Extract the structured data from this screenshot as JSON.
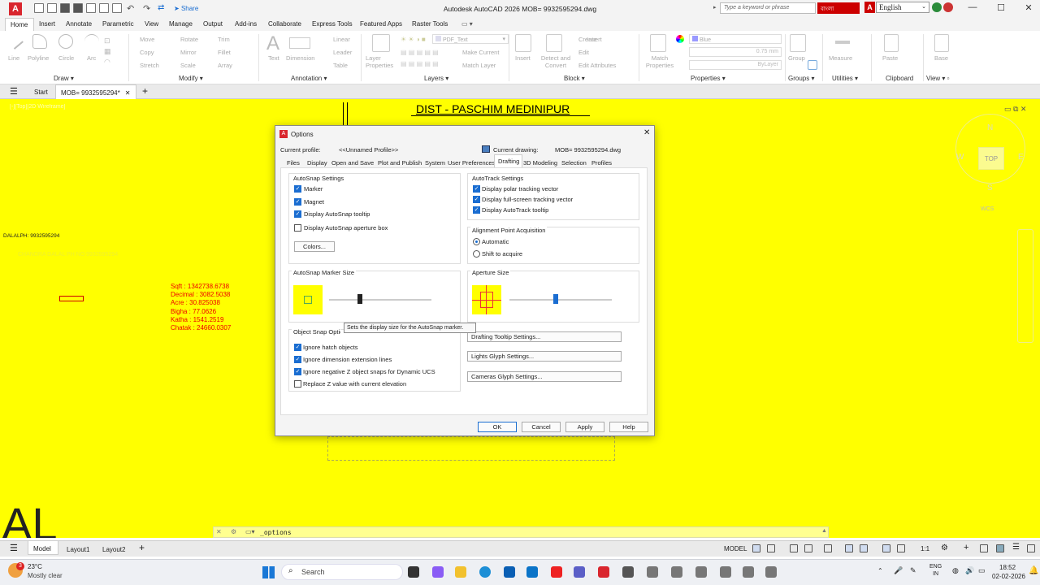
{
  "window": {
    "title": "Autodesk AutoCAD 2026    MOB= 9932595294.dwg",
    "logo": "A",
    "share": "Share",
    "search_placeholder": "Type a keyword or phrase",
    "bangla": "বাংলা",
    "lang_icon": "A",
    "language": "English"
  },
  "menu": [
    "Home",
    "Insert",
    "Annotate",
    "Parametric",
    "View",
    "Manage",
    "Output",
    "Add-ins",
    "Collaborate",
    "Express Tools",
    "Featured Apps",
    "Raster Tools"
  ],
  "ribbon": {
    "draw_tools": [
      "Line",
      "Polyline",
      "Circle",
      "Arc"
    ],
    "modify_tools": [
      "Move",
      "Rotate",
      "Trim",
      "Copy",
      "Mirror",
      "Fillet",
      "Stretch",
      "Scale",
      "Array"
    ],
    "annotation_tools": [
      "Text",
      "Dimension",
      "Linear",
      "Leader",
      "Table"
    ],
    "layer_props": "Layer Properties",
    "layer_tools": [
      "Create",
      "Edit",
      "Make Current",
      "Match Layer"
    ],
    "layer_current": "PDF_Text",
    "block_tools": [
      "Insert",
      "Detect and Convert",
      "Edit Attributes"
    ],
    "match_props": "Match Properties",
    "color": "Blue",
    "lineweight": "0.75 mm",
    "linetype": "ByLayer",
    "group": "Group",
    "measure": "Measure",
    "paste": "Paste",
    "base": "Base",
    "panels": [
      "Draw",
      "Modify",
      "Annotation",
      "Layers",
      "Block",
      "Properties",
      "Groups",
      "Utilities",
      "Clipboard",
      "View"
    ]
  },
  "doctabs": {
    "start": "Start",
    "active": "MOB= 9932595294*"
  },
  "canvas": {
    "viewport_label": "[-][Top][2D Wireframe]",
    "title": "DIST - PASCHIM MEDINIPUR",
    "dalalph": "DALALPH: 9932595294",
    "faded": "CHANDRA DALAL PH NO 9932595294",
    "areas": [
      "Sqft    : 1342738.6738",
      "Decimal : 3082.5038",
      "Acre    : 30.825038",
      "Bigha   : 77.0626",
      "Katha   : 1541.2519",
      "Chatak  : 24660.0307"
    ],
    "big_text": "AL",
    "viewcube": {
      "n": "N",
      "s": "S",
      "e": "E",
      "w": "W",
      "top": "TOP",
      "wcs": "WCS"
    }
  },
  "dialog": {
    "title": "Options",
    "current_profile_label": "Current profile:",
    "current_profile": "<<Unnamed Profile>>",
    "current_drawing_label": "Current drawing:",
    "current_drawing": "MOB= 9932595294.dwg",
    "tabs": [
      "Files",
      "Display",
      "Open and Save",
      "Plot and Publish",
      "System",
      "User Preferences",
      "Drafting",
      "3D Modeling",
      "Selection",
      "Profiles"
    ],
    "active_tab": "Drafting",
    "autosnap": {
      "title": "AutoSnap Settings",
      "marker": "Marker",
      "magnet": "Magnet",
      "tooltip": "Display AutoSnap tooltip",
      "aperture": "Display AutoSnap aperture box",
      "colors": "Colors..."
    },
    "autotrack": {
      "title": "AutoTrack Settings",
      "polar": "Display polar tracking vector",
      "fullscreen": "Display full-screen tracking vector",
      "tooltip": "Display AutoTrack tooltip"
    },
    "alignment": {
      "title": "Alignment Point Acquisition",
      "automatic": "Automatic",
      "shift": "Shift to acquire"
    },
    "marker_size": {
      "title": "AutoSnap Marker Size",
      "level": 0.3
    },
    "aperture_size": {
      "title": "Aperture Size",
      "level": 0.45
    },
    "osnap": {
      "title": "Object Snap Options",
      "hatch": "Ignore hatch objects",
      "dimext": "Ignore dimension extension lines",
      "negz": "Ignore negative Z object snaps for Dynamic UCS",
      "replacez": "Replace Z value with current elevation"
    },
    "buttons_right": [
      "Drafting Tooltip Settings...",
      "Lights Glyph Settings...",
      "Cameras Glyph Settings..."
    ],
    "tooltip": "Sets the display size for the AutoSnap marker.",
    "footer": {
      "ok": "OK",
      "cancel": "Cancel",
      "apply": "Apply",
      "help": "Help"
    }
  },
  "command": {
    "value": "_options"
  },
  "layouts": {
    "model": "Model",
    "layout1": "Layout1",
    "layout2": "Layout2"
  },
  "status": {
    "model": "MODEL",
    "scale": "1:1"
  },
  "taskbar": {
    "temp": "23°C",
    "weather": "Mostly clear",
    "badge": "3",
    "search": "Search",
    "lang1": "ENG",
    "lang2": "IN",
    "time": "18:52",
    "date": "02-02-2026"
  }
}
